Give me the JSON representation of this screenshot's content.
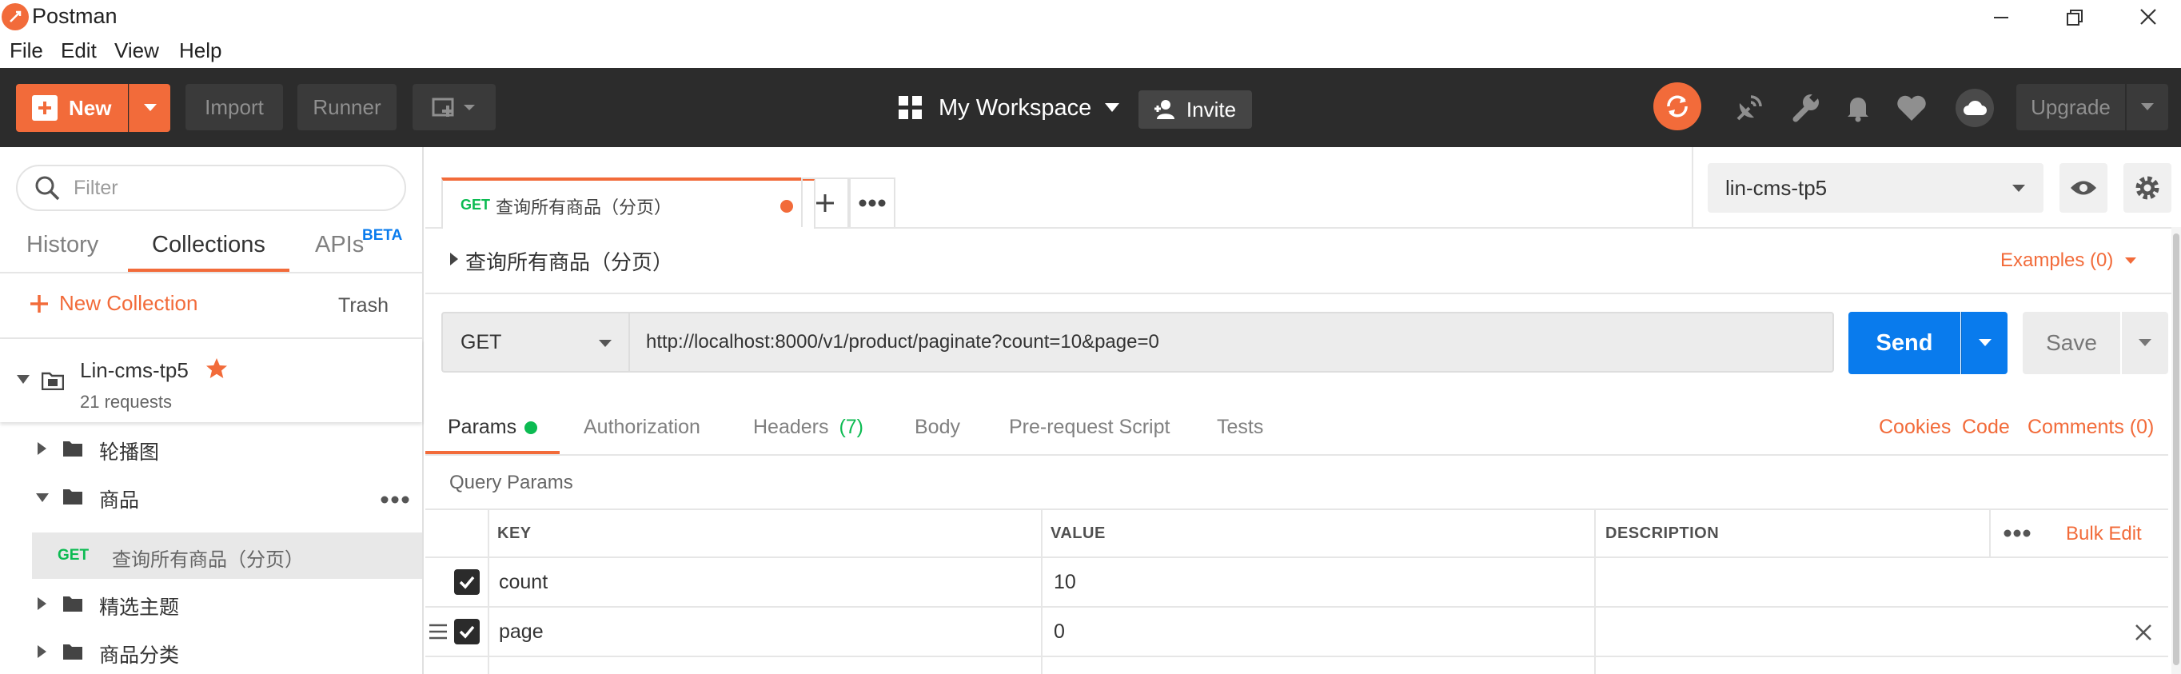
{
  "window": {
    "title": "Postman"
  },
  "menu": [
    "File",
    "Edit",
    "View",
    "Help"
  ],
  "toolbar": {
    "new_label": "New",
    "import_label": "Import",
    "runner_label": "Runner",
    "workspace_label": "My Workspace",
    "invite_label": "Invite",
    "upgrade_label": "Upgrade"
  },
  "sidebar": {
    "filter_placeholder": "Filter",
    "tabs": {
      "history": "History",
      "collections": "Collections",
      "apis": "APIs",
      "apis_badge": "BETA"
    },
    "new_collection_label": "New Collection",
    "trash_label": "Trash",
    "collection": {
      "name": "Lin-cms-tp5",
      "count": "21 requests"
    },
    "folders": [
      {
        "name": "轮播图"
      },
      {
        "name": "商品"
      },
      {
        "name": "精选主题"
      },
      {
        "name": "商品分类"
      }
    ],
    "request": {
      "method": "GET",
      "name": "查询所有商品（分页）"
    }
  },
  "request_tab": {
    "method": "GET",
    "name": "查询所有商品（分页）"
  },
  "environment": {
    "selected": "lin-cms-tp5"
  },
  "request": {
    "title": "查询所有商品（分页）",
    "examples_label": "Examples (0)",
    "method": "GET",
    "url": "http://localhost:8000/v1/product/paginate?count=10&page=0",
    "send_label": "Send",
    "save_label": "Save"
  },
  "request_tabs": {
    "params": "Params",
    "authorization": "Authorization",
    "headers": "Headers",
    "headers_count": "(7)",
    "body": "Body",
    "prerequest": "Pre-request Script",
    "tests": "Tests",
    "cookies": "Cookies",
    "code": "Code",
    "comments": "Comments (0)"
  },
  "query_params": {
    "title": "Query Params",
    "headers": {
      "key": "KEY",
      "value": "VALUE",
      "description": "DESCRIPTION",
      "bulk_edit": "Bulk Edit"
    },
    "rows": [
      {
        "key": "count",
        "value": "10",
        "checked": true
      },
      {
        "key": "page",
        "value": "0",
        "checked": true
      }
    ]
  },
  "colors": {
    "accent": "#f26b3a",
    "send_blue": "#097bed",
    "dark_bar": "#2c2c2c",
    "green": "#0cbb52"
  }
}
